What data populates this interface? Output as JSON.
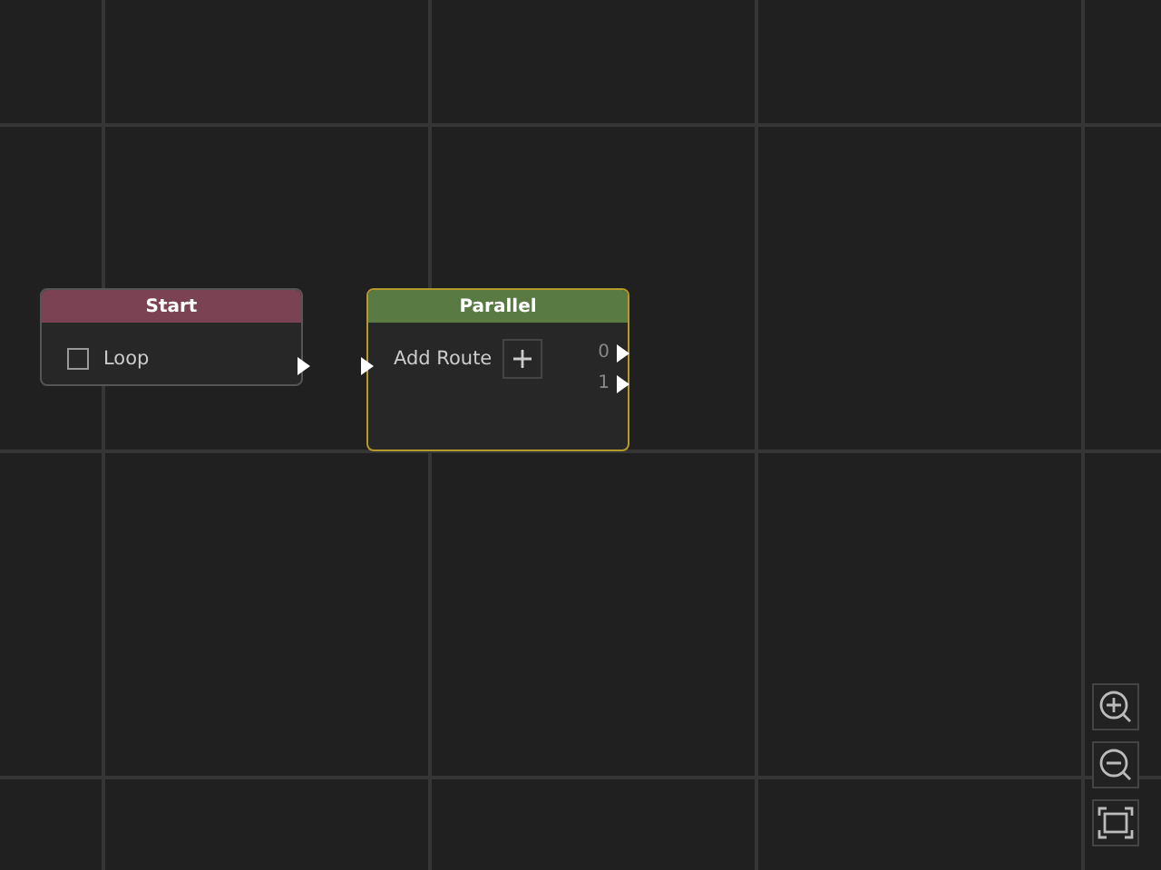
{
  "nodes": [
    {
      "title": "Start",
      "color": "#7a4253",
      "selected": false,
      "input": false,
      "output": true,
      "rows": [
        {
          "kind": "checkbox",
          "label": "Loop",
          "checked": false
        }
      ]
    },
    {
      "title": "Parallel",
      "color": "#5a7a44",
      "selected": true,
      "input": true,
      "output": false,
      "rows": [
        {
          "kind": "add",
          "label": "Add Route"
        }
      ],
      "outputs": [
        "0",
        "1"
      ]
    }
  ],
  "zoom_controls": [
    {
      "kind": "zoom-in"
    },
    {
      "kind": "zoom-out"
    },
    {
      "kind": "fit"
    }
  ]
}
